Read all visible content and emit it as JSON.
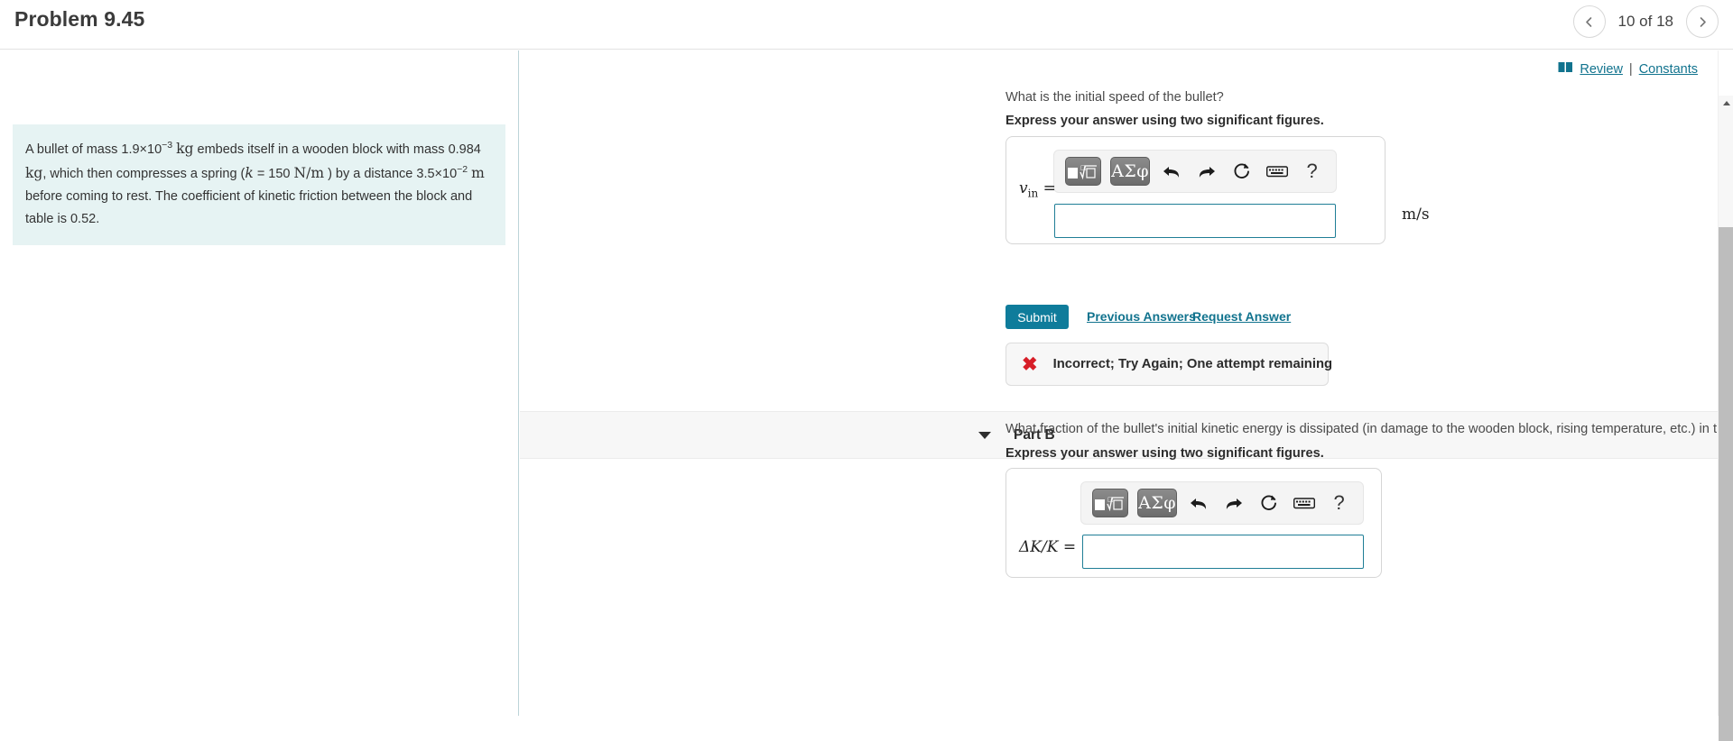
{
  "header": {
    "title": "Problem 9.45",
    "pager": {
      "prev_icon": "chevron-left-icon",
      "next_icon": "chevron-right-icon",
      "count": "10 of 18"
    }
  },
  "resources": {
    "book_icon": "book-icon",
    "review_label": "Review",
    "separator": "|",
    "constants_label": "Constants"
  },
  "problem": {
    "text_segments": [
      "A bullet of mass 1.9×10",
      "−3",
      " kg embeds itself in a wooden block with mass 0.984 kg , which then compresses a spring (k = 150 N/m ) by a distance 3.5×10",
      "−2",
      " m before coming to rest. The coefficient of kinetic friction between the block and table is 0.52."
    ],
    "line1_a": "A bullet of mass 1.9×10",
    "line1_exp": "−3",
    "line1_b": "kg",
    "line1_c": "embeds itself in a wooden block with",
    "line2_a": "mass 0.984",
    "line2_b": "kg",
    "line2_c": ", which then compresses a spring (",
    "line2_k": "k",
    "line2_d": "= 150",
    "line2_unit": "N/m",
    "line2_e": ") by",
    "line3_a": "a distance 3.5×10",
    "line3_exp": "−2",
    "line3_b": "m",
    "line3_c": "before coming to rest. The coefficient of kinetic",
    "line4": "friction between the block and table is 0.52."
  },
  "part_a": {
    "question": "What is the initial speed of the bullet?",
    "instruction": "Express your answer using two significant figures.",
    "toolbar": {
      "template_button": "template-icon",
      "symbols_button": "ΑΣφ",
      "undo_icon": "undo-icon",
      "redo_icon": "redo-icon",
      "reset_icon": "reset-icon",
      "keyboard_icon": "keyboard-icon",
      "help_label": "?"
    },
    "answer_label_var": "v",
    "answer_label_sub": "in",
    "answer_label_eq": "=",
    "answer_value": "",
    "unit": "m/s",
    "submit_label": "Submit",
    "previous_answers_label": "Previous Answers",
    "request_answer_label": "Request Answer",
    "feedback": {
      "icon": "x-mark-icon",
      "text": "Incorrect; Try Again; One attempt remaining"
    }
  },
  "part_b": {
    "caret_icon": "caret-down-icon",
    "header_label": "Part B",
    "question": "What fraction of the bullet's initial kinetic energy is dissipated (in damage to the wooden block, rising temperature, etc.) in the collision between the bullet and the block?",
    "instruction": "Express your answer using two significant figures.",
    "toolbar": {
      "template_button": "template-icon",
      "symbols_button": "ΑΣφ",
      "undo_icon": "undo-icon",
      "redo_icon": "redo-icon",
      "reset_icon": "reset-icon",
      "keyboard_icon": "keyboard-icon",
      "help_label": "?"
    },
    "answer_label": "ΔK/K",
    "answer_label_eq": "=",
    "answer_value": ""
  },
  "colors": {
    "accent": "#0f7c9b",
    "link": "#11738e",
    "problem_bg": "#e6f3f3",
    "error": "#d71e28"
  }
}
